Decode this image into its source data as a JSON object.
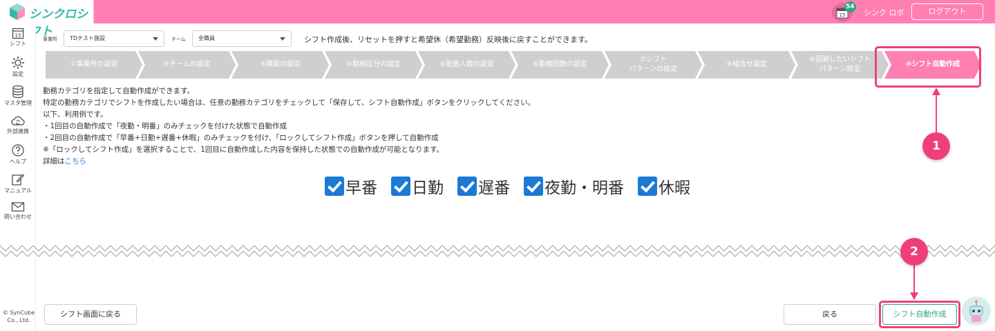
{
  "header": {
    "logo_text": "シンクロシフト",
    "notification_count": "54",
    "calendar_day": "15",
    "user_name": "シンク ロボ",
    "logout_label": "ログアウト"
  },
  "sidebar": {
    "items": [
      {
        "label": "シフト",
        "icon": "calendar-icon"
      },
      {
        "label": "設定",
        "icon": "gear-icon"
      },
      {
        "label": "マスタ管理",
        "icon": "database-icon"
      },
      {
        "label": "外部連携",
        "icon": "cloud-sync-icon"
      },
      {
        "label": "ヘルプ",
        "icon": "help-icon"
      },
      {
        "label": "マニュアル",
        "icon": "edit-icon"
      },
      {
        "label": "問い合わせ",
        "icon": "mail-icon"
      }
    ],
    "calendar_day": "15",
    "copyright": "© SynCube Co., Ltd."
  },
  "filters": {
    "office_label": "事業所",
    "office_value": "TDテスト施設",
    "team_label": "チーム",
    "team_value": "全職員",
    "reset_note": "シフト作成後、リセットを押すと希望休（希望勤務）反映後に戻すことができます。"
  },
  "steps": [
    {
      "label": "①事業所の設定",
      "active": false
    },
    {
      "label": "②チームの設定",
      "active": false
    },
    {
      "label": "③職員の設定",
      "active": false
    },
    {
      "label": "④勤務区分の設定",
      "active": false
    },
    {
      "label": "⑤配置人数の設定",
      "active": false
    },
    {
      "label": "⑥勤務回数の設定",
      "active": false
    },
    {
      "label": "⑦シフト\nパターンの設定",
      "active": false
    },
    {
      "label": "⑧組合せ設定",
      "active": false
    },
    {
      "label": "⑨回避したいシフト\nパターン設定",
      "active": false
    },
    {
      "label": "⑩シフト自動作成",
      "active": true
    }
  ],
  "description": {
    "line1": "勤務カテゴリを指定して自動作成ができます。",
    "line2": "特定の勤務カテゴリでシフトを作成したい場合は、任意の勤務カテゴリをチェックして「保存して、シフト自動作成」ボタンをクリックしてください。",
    "line3": "以下、利用例です。",
    "line4": "・1回目の自動作成で「夜勤・明番」のみチェックを付けた状態で自動作成",
    "line5": "・2回目の自動作成で「早番+日勤+遅番+休暇」のみチェックを付け、「ロックしてシフト作成」ボタンを押して自動作成",
    "line6": "※「ロックしてシフト作成」を選択することで、1回目に自動作成した内容を保持した状態での自動作成が可能となります。",
    "details_prefix": "詳細は",
    "details_link": "こちら"
  },
  "categories": [
    {
      "label": "早番",
      "checked": true
    },
    {
      "label": "日勤",
      "checked": true
    },
    {
      "label": "遅番",
      "checked": true
    },
    {
      "label": "夜勤・明番",
      "checked": true
    },
    {
      "label": "休暇",
      "checked": true
    }
  ],
  "callouts": {
    "one": "1",
    "two": "2"
  },
  "buttons": {
    "back_to_shift": "シフト画面に戻る",
    "back": "戻る",
    "auto_create": "シフト自動作成"
  },
  "colors": {
    "brand_pink": "#ff7fb3",
    "callout_red": "#ee3f79",
    "accent_green": "#34a37f",
    "checkbox_blue": "#1a7ad6",
    "step_inactive": "#cfcfcf"
  }
}
